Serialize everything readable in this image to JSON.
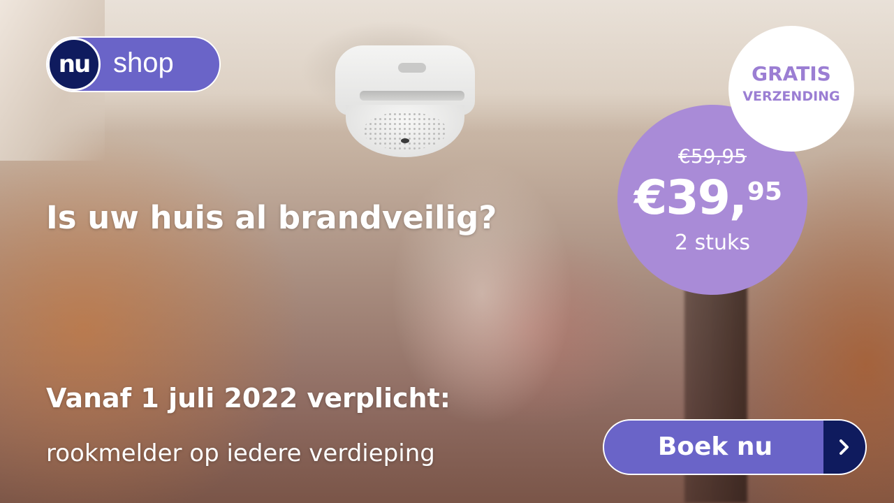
{
  "brand": {
    "logo_mark": "nu",
    "logo_text": "shop",
    "logo_mark_color": "#0f1b5e",
    "logo_pill_color": "#6a64c8"
  },
  "headline": "Is uw huis al brandveilig?",
  "subheadline": "Vanaf 1 juli 2022 verplicht:",
  "subtext": "rookmelder op iedere verdieping",
  "shipping_badge": {
    "line1": "GRATIS",
    "line2": "VERZENDING",
    "text_color": "#9b7ed3"
  },
  "price_badge": {
    "old_price": "€59,95",
    "new_price_main": "€39,",
    "new_price_cents": "95",
    "quantity": "2 stuks",
    "color": "#a98bd7"
  },
  "cta": {
    "label": "Boek nu",
    "icon": "chevron-right-icon"
  }
}
